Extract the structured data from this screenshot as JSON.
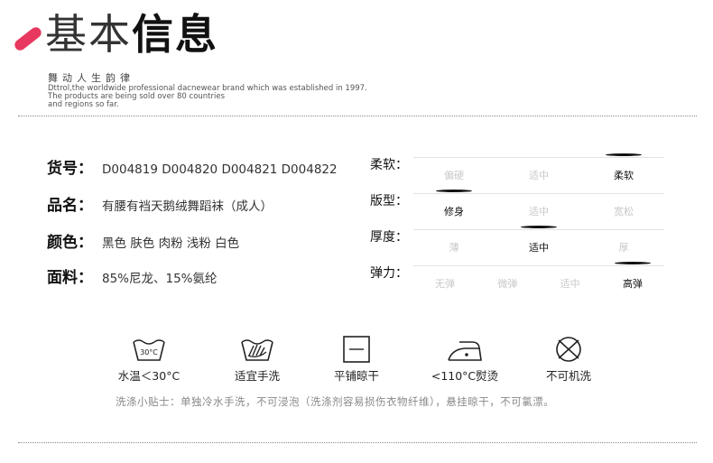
{
  "header": {
    "title_part1": "基本",
    "title_part2": "信息",
    "subtitle": "舞动人生韵律",
    "description": "Dttrol,the worldwide professional dacnewear brand which was established in 1997.\nThe products are being sold over 80 countries\nand regions so far.",
    "accent_color": "#e8385f"
  },
  "info": [
    {
      "label": "货号：",
      "value": "D004819  D004820  D004821 D004822"
    },
    {
      "label": "品名：",
      "value": "有腰有裆天鹅绒舞蹈袜（成人）"
    },
    {
      "label": "颜色：",
      "value": "黑色  肤色  肉粉  浅粉  白色"
    },
    {
      "label": "面料：",
      "value": "85%尼龙、15%氨纶"
    }
  ],
  "scales": [
    {
      "label": "柔软：",
      "options": [
        "偏硬",
        "适中",
        "柔软"
      ],
      "selected": 2
    },
    {
      "label": "版型：",
      "options": [
        "修身",
        "适中",
        "宽松"
      ],
      "selected": 0
    },
    {
      "label": "厚度：",
      "options": [
        "薄",
        "适中",
        "厚"
      ],
      "selected": 1
    },
    {
      "label": "弹力：",
      "options": [
        "无弹",
        "微弹",
        "适中",
        "高弹"
      ],
      "selected": 3
    }
  ],
  "care": [
    {
      "icon": "wash-30-icon",
      "icon_text": "30°C",
      "label": "水温＜30°C"
    },
    {
      "icon": "hand-wash-icon",
      "label": "适宜手洗"
    },
    {
      "icon": "flat-dry-icon",
      "label": "平铺晾干"
    },
    {
      "icon": "iron-icon",
      "label": "<110°C熨烫"
    },
    {
      "icon": "no-machine-wash-icon",
      "label": "不可机洗"
    }
  ],
  "tip": "洗涤小贴士：单独冷水手洗，不可浸泡（洗涤剂容易损伤衣物纤维），悬挂晾干，不可氯漂。"
}
